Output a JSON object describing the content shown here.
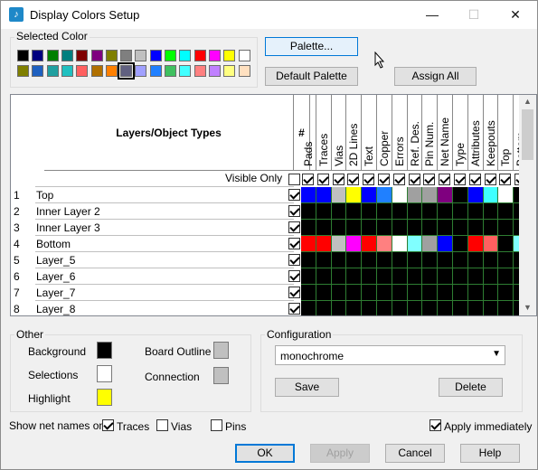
{
  "window": {
    "title": "Display Colors Setup",
    "minimize": "—",
    "maximize": "☐",
    "close": "✕"
  },
  "selected_color": {
    "label": "Selected Color",
    "palette_row1": [
      "#000000",
      "#00007f",
      "#007f00",
      "#007f7f",
      "#7f0000",
      "#7f007f",
      "#7f7f00",
      "#7f7f7f",
      "#c0c0c0",
      "#0000ff",
      "#00ff00",
      "#00ffff",
      "#ff0000",
      "#ff00ff",
      "#ffff00",
      "#ffffff"
    ],
    "palette_row2": [
      "#7f7f00",
      "#1e60c0",
      "#20a0a0",
      "#20c0c0",
      "#ff6060",
      "#b07000",
      "#ff8000",
      "#606080",
      "#a0a0ff",
      "#2080ff",
      "#40c060",
      "#40ffff",
      "#ff8080",
      "#c080ff",
      "#ffff80",
      "#ffe0c0"
    ],
    "selected_index": 7
  },
  "buttons": {
    "palette": "Palette...",
    "default_palette": "Default Palette",
    "assign_all": "Assign All",
    "save": "Save",
    "delete": "Delete",
    "ok": "OK",
    "apply": "Apply",
    "cancel": "Cancel",
    "help": "Help"
  },
  "grid": {
    "header": "Layers/Object Types",
    "hash": "#",
    "columns": [
      "Pads",
      "Traces",
      "Vias",
      "2D Lines",
      "Text",
      "Copper",
      "Errors",
      "Ref. Des.",
      "Pin Num.",
      "Net Name",
      "Type",
      "Attributes",
      "Keepouts",
      "Top",
      "Bottom"
    ],
    "visible_only": "Visible Only",
    "rows": [
      {
        "num": "1",
        "name": "Top",
        "colors": [
          "#0000ff",
          "#0000ff",
          "#c0c0c0",
          "#ffff00",
          "#0000ff",
          "#2080ff",
          "#ffffff",
          "#a0a0a0",
          "#a0a0a0",
          "#7f007f",
          "#000000",
          "#0000ff",
          "#40ffff",
          "#ffffff",
          "#000000"
        ]
      },
      {
        "num": "2",
        "name": "Inner Layer 2",
        "colors": [
          "#000000",
          "#000000",
          "#000000",
          "#000000",
          "#000000",
          "#000000",
          "#000000",
          "#000000",
          "#000000",
          "#000000",
          "#000000",
          "#000000",
          "#000000",
          "#000000",
          "#000000"
        ]
      },
      {
        "num": "3",
        "name": "Inner Layer 3",
        "colors": [
          "#000000",
          "#000000",
          "#000000",
          "#000000",
          "#000000",
          "#000000",
          "#000000",
          "#000000",
          "#000000",
          "#000000",
          "#000000",
          "#000000",
          "#000000",
          "#000000",
          "#000000"
        ]
      },
      {
        "num": "4",
        "name": "Bottom",
        "colors": [
          "#ff0000",
          "#ff0000",
          "#c0c0c0",
          "#ff00ff",
          "#ff0000",
          "#ff8080",
          "#ffffff",
          "#80ffff",
          "#a0a0a0",
          "#0000ff",
          "#000000",
          "#ff0000",
          "#ff6060",
          "#000000",
          "#80ffff"
        ]
      },
      {
        "num": "5",
        "name": "Layer_5",
        "colors": [
          "#000000",
          "#000000",
          "#000000",
          "#000000",
          "#000000",
          "#000000",
          "#000000",
          "#000000",
          "#000000",
          "#000000",
          "#000000",
          "#000000",
          "#000000",
          "#000000",
          "#000000"
        ]
      },
      {
        "num": "6",
        "name": "Layer_6",
        "colors": [
          "#000000",
          "#000000",
          "#000000",
          "#000000",
          "#000000",
          "#000000",
          "#000000",
          "#000000",
          "#000000",
          "#000000",
          "#000000",
          "#000000",
          "#000000",
          "#000000",
          "#000000"
        ]
      },
      {
        "num": "7",
        "name": "Layer_7",
        "colors": [
          "#000000",
          "#000000",
          "#000000",
          "#000000",
          "#000000",
          "#000000",
          "#000000",
          "#000000",
          "#000000",
          "#000000",
          "#000000",
          "#000000",
          "#000000",
          "#000000",
          "#000000"
        ]
      },
      {
        "num": "8",
        "name": "Layer_8",
        "colors": [
          "#000000",
          "#000000",
          "#000000",
          "#000000",
          "#000000",
          "#000000",
          "#000000",
          "#000000",
          "#000000",
          "#000000",
          "#000000",
          "#000000",
          "#000000",
          "#000000",
          "#000000"
        ]
      }
    ]
  },
  "other": {
    "label": "Other",
    "background": "Background",
    "background_color": "#000000",
    "selections": "Selections",
    "selections_color": "#ffffff",
    "highlight": "Highlight",
    "highlight_color": "#ffff00",
    "board_outline": "Board Outline",
    "board_outline_color": "#c0c0c0",
    "connection": "Connection",
    "connection_color": "#c0c0c0"
  },
  "configuration": {
    "label": "Configuration",
    "value": "monochrome"
  },
  "bottom": {
    "show_net_names_on": "Show net names on",
    "traces": "Traces",
    "vias": "Vias",
    "pins": "Pins",
    "apply_immediately": "Apply immediately"
  }
}
